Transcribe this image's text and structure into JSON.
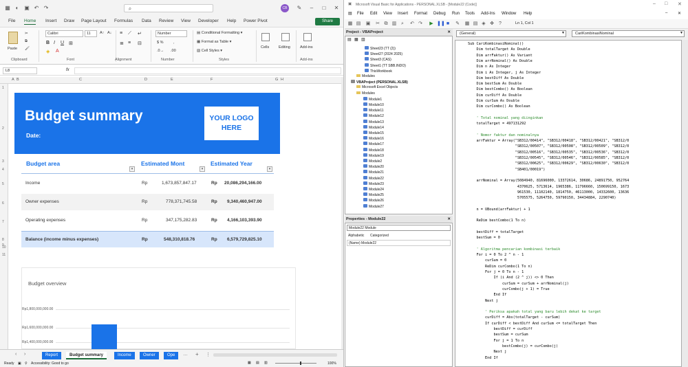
{
  "excel": {
    "title_initials": "CB",
    "tabs": [
      "File",
      "Home",
      "Insert",
      "Draw",
      "Page Layout",
      "Formulas",
      "Data",
      "Review",
      "View",
      "Developer",
      "Help",
      "Power Pivot"
    ],
    "share": "Share",
    "ribbon": {
      "paste": "Paste",
      "font_name": "Calibri",
      "font_size": "11",
      "number_format": "Number",
      "conditional": "Conditional Formatting",
      "format_table": "Format as Table",
      "cell_styles": "Cell Styles",
      "cells": "Cells",
      "editing": "Editing",
      "addins": "Add-ins",
      "groups": [
        "Clipboard",
        "Font",
        "Alignment",
        "Number",
        "Styles",
        "Add-ins"
      ]
    },
    "name_box": "L8",
    "fx": "fx",
    "columns": [
      "A",
      "B",
      "C",
      "D",
      "E",
      "F",
      "G",
      "H"
    ],
    "rows": [
      "1",
      "2",
      "3",
      "4",
      "5",
      "6",
      "7",
      "8",
      "9",
      "10",
      "11"
    ],
    "banner": {
      "title": "Budget summary",
      "date_label": "Date:",
      "logo": "YOUR LOGO HERE"
    },
    "table": {
      "headers": [
        "Budget area",
        "Estimated Mont",
        "Estimated Year"
      ],
      "rows": [
        {
          "area": "Income",
          "cur1": "Rp",
          "month": "1,673,857,847.17",
          "cur2": "Rp",
          "year": "20,086,294,166.00"
        },
        {
          "area": "Owner expenses",
          "cur1": "Rp",
          "month": "778,371,745.58",
          "cur2": "Rp",
          "year": "9,340,460,947.00"
        },
        {
          "area": "Operating expenses",
          "cur1": "Rp",
          "month": "347,175,282.83",
          "cur2": "Rp",
          "year": "4,166,103,393.90"
        },
        {
          "area": "Balance (income minus expenses)",
          "cur1": "Rp",
          "month": "548,310,818.76",
          "cur2": "Rp",
          "year": "6,579,729,825.10"
        }
      ]
    },
    "chart": {
      "title": "Budget overview",
      "ticks": [
        "Rp1,800,000,000.00",
        "Rp1,600,000,000.00",
        "Rp1,400,000,000.00"
      ]
    },
    "sheet_tabs": [
      "Report",
      "Budget summary",
      "Income",
      "Owner",
      "Ope"
    ],
    "status": {
      "ready": "Ready",
      "accessibility": "Accessibility: Good to go",
      "zoom": "100%"
    }
  },
  "vbe": {
    "title": "Microsoft Visual Basic for Applications - PERSONAL.XLSB - [Module22 (Code)]",
    "menu": [
      "File",
      "Edit",
      "View",
      "Insert",
      "Format",
      "Debug",
      "Run",
      "Tools",
      "Add-Ins",
      "Window",
      "Help"
    ],
    "position": "Ln 1, Col 1",
    "project_title": "Project - VBAProject",
    "tree": [
      "Sheet23 (TT (2))",
      "Sheet27 (2024 2025)",
      "Sheet3 (CAS)",
      "Sheet1 (TT SBB.INDO)",
      "ThisWorkbook",
      "Modules",
      "VBAProject (PERSONAL.XLSB)",
      "Microsoft Excel Objects",
      "Modules",
      "Module1",
      "Module10",
      "Module11",
      "Module12",
      "Module13",
      "Module14",
      "Module15",
      "Module16",
      "Module17",
      "Module18",
      "Module19",
      "Module2",
      "Module20",
      "Module21",
      "Module22",
      "Module23",
      "Module24",
      "Module25",
      "Module26",
      "Module27"
    ],
    "properties_title": "Properties - Module22",
    "prop_object": "Module22 Module",
    "prop_tabs": [
      "Alphabetic",
      "Categorized"
    ],
    "prop_name": "(Name) Module22",
    "combo_general": "(General)",
    "combo_proc": "CariKombinasiNominal",
    "code": [
      "Sub CariKombinasiNominal()",
      "    Dim totalTarget As Double",
      "    Dim arrFaktur() As Variant",
      "    Dim arrNominal() As Double",
      "    Dim n As Integer",
      "    Dim i As Integer, j As Integer",
      "    Dim bestDiff As Double",
      "    Dim bestSum As Double",
      "    Dim bestCombo() As Boolean",
      "    Dim curDiff As Double",
      "    Dim curSum As Double",
      "    Dim curCombo() As Boolean",
      "",
      "    ' Total nominal yang diinginkan",
      "    totalTarget = 497131292",
      "",
      "    ' Nomor faktur dan nominalnya",
      "    arrFaktur = Array(\"SB312/00414\", \"SB312/00418\", \"SB312/00421\", \"SB312/0",
      "                      \"SB312/00507\", \"SB312/00508\", \"SB312/00509\", \"SB312/0",
      "                      \"SB312/00516\", \"SB312/00535\", \"SB312/00536\", \"SB312/0",
      "                      \"SB312/00545\", \"SB312/00546\", \"SB312/00585\", \"SB312/0",
      "                      \"SB312/00625\", \"SB312/00629\", \"SB312/00630\", \"SB312/0",
      "                      \"SB401/00019\")",
      "",
      "    arrNominal = Array(5084940, 81696000, 13372614, 30686, 24891750, 952764",
      "                       4370625, 5713614, 1965386, 11796660, 150699150, 1673",
      "                       961530, 11102140, 1814750, 46113000, 14332600, 13636",
      "                       5705575, 5264750, 59790150, 34434884, 2290740)",
      "",
      "    n = UBound(arrFaktur) + 1",
      "",
      "    ReDim bestCombo(1 To n)",
      "",
      "    bestDiff = totalTarget",
      "    bestSum = 0",
      "",
      "    ' Algoritma pencarian kombinasi terbaik",
      "    For i = 0 To 2 ^ n - 1",
      "        curSum = 0",
      "        ReDim curCombo(1 To n)",
      "        For j = 0 To n - 1",
      "            If (i And (2 ^ j)) <> 0 Then",
      "                curSum = curSum + arrNominal(j)",
      "                curCombo(j + 1) = True",
      "            End If",
      "        Next j",
      "",
      "        ' Periksa apakah total yang baru lebih dekat ke target",
      "        curDiff = Abs(totalTarget - curSum)",
      "        If curDiff < bestDiff And curSum <= totalTarget Then",
      "            bestDiff = curDiff",
      "            bestSum = curSum",
      "            For j = 1 To n",
      "                bestCombo(j) = curCombo(j)",
      "            Next j",
      "        End If"
    ]
  }
}
